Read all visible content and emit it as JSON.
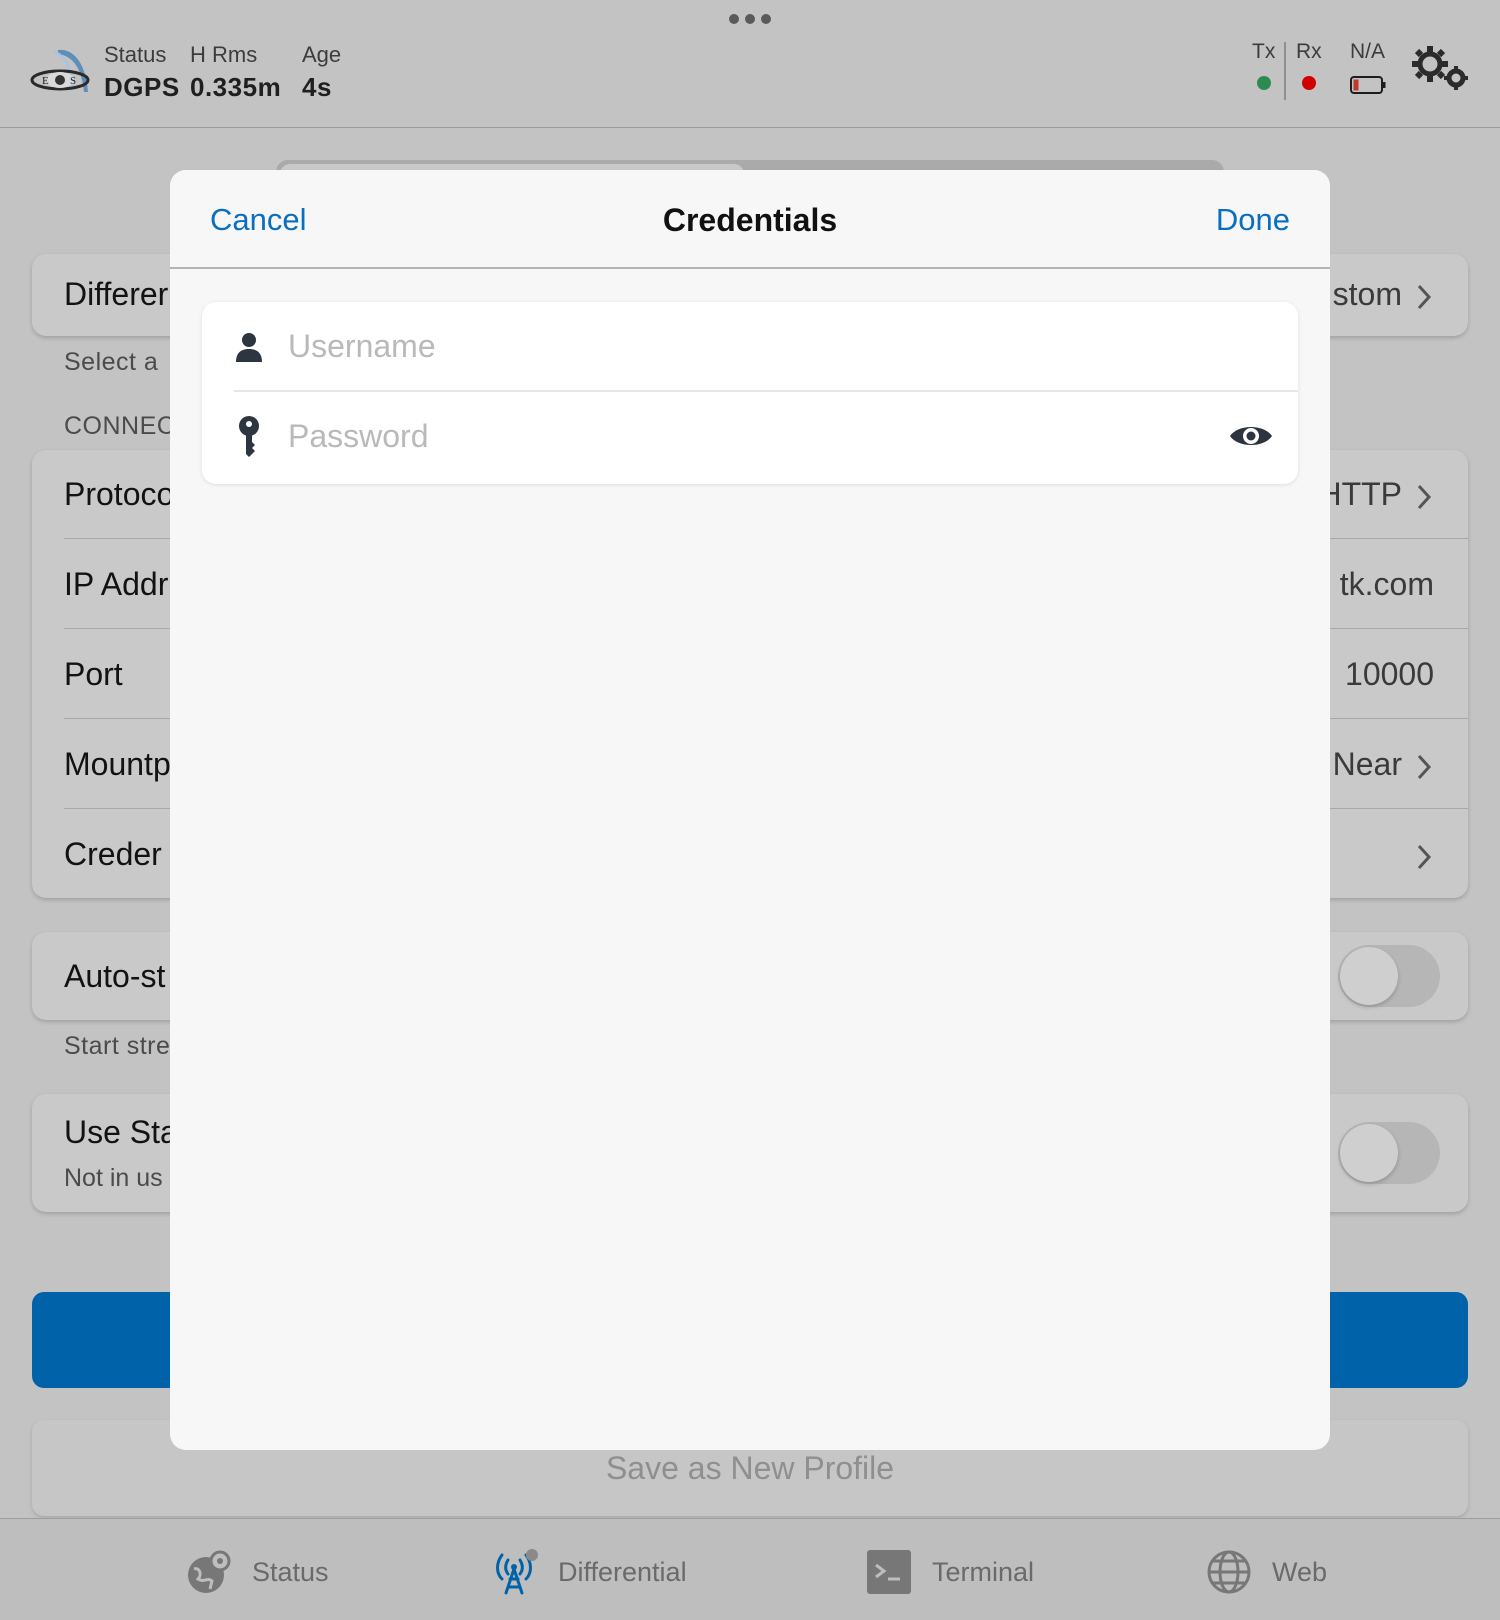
{
  "header": {
    "status_label": "Status",
    "status_value": "DGPS",
    "hrms_label": "H Rms",
    "hrms_value": "0.335m",
    "age_label": "Age",
    "age_value": "4s",
    "tx_label": "Tx",
    "rx_label": "Rx",
    "battery_label": "N/A",
    "tx_color": "#2e8b4f",
    "rx_color": "#d10000"
  },
  "background": {
    "differential_label": "Differer",
    "differential_value": "stom",
    "select_note": "Select a",
    "section_header": "CONNEC",
    "protocol_label": "Protoco",
    "protocol_value": "HTTP",
    "ip_label": "IP Addr",
    "ip_value": "tk.com",
    "port_label": "Port",
    "port_value": "10000",
    "mount_label": "Mountp",
    "mount_value": "Near",
    "cred_label": "Creder",
    "autostart_label": "Auto-st",
    "autostart_note": "Start stre",
    "usesta_label": "Use Sta",
    "usesta_note": "Not in us",
    "save_profile_label": "Save as New Profile"
  },
  "modal": {
    "cancel_label": "Cancel",
    "title": "Credentials",
    "done_label": "Done",
    "username_placeholder": "Username",
    "username_value": "",
    "password_placeholder": "Password",
    "password_value": ""
  },
  "tabs": [
    {
      "label": "Status",
      "icon": "globe-pin-icon"
    },
    {
      "label": "Differential",
      "icon": "antenna-icon"
    },
    {
      "label": "Terminal",
      "icon": "terminal-icon"
    },
    {
      "label": "Web",
      "icon": "globe-icon"
    }
  ],
  "colors": {
    "accent": "#0b6fc0",
    "primary_button": "#0062a8"
  }
}
